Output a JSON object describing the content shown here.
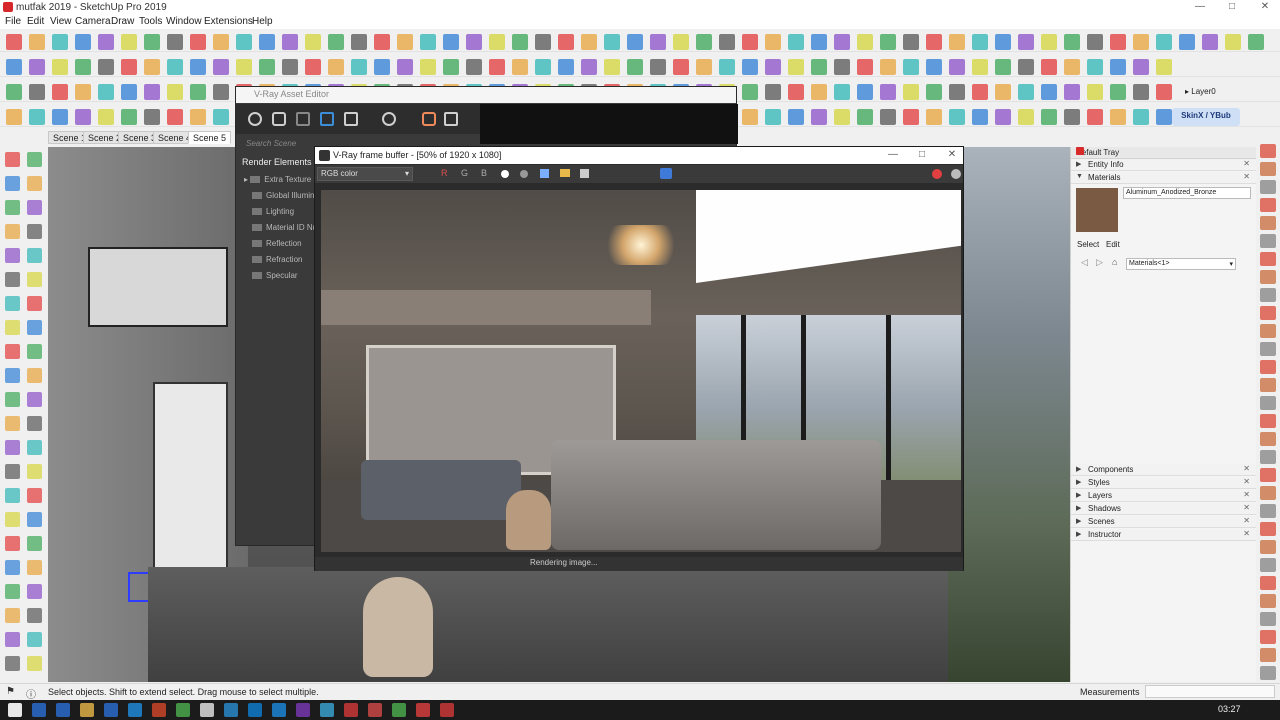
{
  "app": {
    "title": "mutfak 2019 - SketchUp Pro 2019",
    "controls": [
      "—",
      "□",
      "✕"
    ]
  },
  "menu": [
    "File",
    "Edit",
    "View",
    "Camera",
    "Draw",
    "Tools",
    "Window",
    "Extensions",
    "Help"
  ],
  "scenes": [
    "Scene 1",
    "Scene 2",
    "Scene 3",
    "Scene 4",
    "Scene 5"
  ],
  "asset_editor": {
    "title": "V-Ray Asset Editor",
    "search_placeholder": "Search Scene",
    "heading": "Render Elements",
    "items": [
      "Extra Texture",
      "Global Illumin",
      "Lighting",
      "Material ID Nu",
      "Reflection",
      "Refraction",
      "Specular"
    ]
  },
  "frame_buffer": {
    "title": "V-Ray frame buffer - [50% of 1920 x 1080]",
    "channel": "RGB color",
    "channels": [
      "R",
      "G",
      "B"
    ],
    "status": "Rendering image...",
    "controls": [
      "—",
      "□",
      "✕"
    ]
  },
  "tray": {
    "title": "Default Tray",
    "sections_top": [
      "Entity Info",
      "Materials"
    ],
    "material_name": "Aluminum_Anodized_Bronze",
    "tabs": [
      "Select",
      "Edit"
    ],
    "library": "Materials<1>",
    "layer": "Layer0",
    "sections_bottom": [
      "Components",
      "Styles",
      "Layers",
      "Shadows",
      "Scenes",
      "Instructor"
    ],
    "swatch_color": "#7a5a42"
  },
  "status": {
    "message": "Select objects. Shift to extend select. Drag mouse to select multiple.",
    "measurements_label": "Measurements"
  },
  "toolbar": {
    "extension_label": "SkinX / YBub"
  },
  "taskbar": {
    "clock": "03:27"
  }
}
